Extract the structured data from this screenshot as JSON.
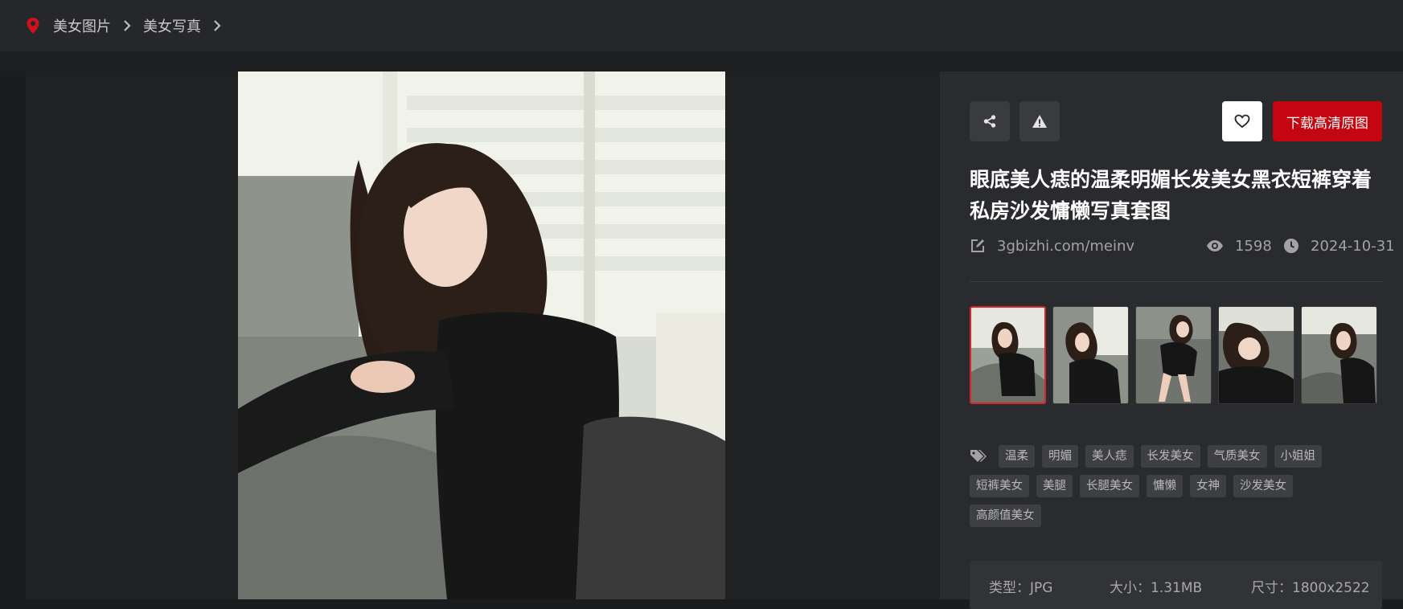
{
  "breadcrumb": {
    "items": [
      "美女图片",
      "美女写真"
    ]
  },
  "actions": {
    "download_label": "下载高清原图"
  },
  "post": {
    "title": "眼底美人痣的温柔明媚长发美女黑衣短裤穿着私房沙发慵懒写真套图",
    "source": "3gbizhi.com/meinv",
    "views": "1598",
    "date": "2024-10-31"
  },
  "thumbnails": {
    "count": 5,
    "active_index": 0
  },
  "tags": {
    "row1": [
      "温柔",
      "明媚",
      "美人痣",
      "长发美女",
      "气质美女",
      "小姐姐"
    ],
    "row2": [
      "短裤美女",
      "美腿",
      "长腿美女",
      "慵懒",
      "女神",
      "沙发美女"
    ],
    "row3": [
      "高颜值美女"
    ]
  },
  "file_info": {
    "type_label": "类型：JPG",
    "size_label": "大小：1.31MB",
    "dim_label": "尺寸：1800x2522"
  },
  "icons": {
    "location": "map-pin-icon",
    "chevron": "chevron-right-icon",
    "share": "share-icon",
    "report": "warning-icon",
    "favorite": "heart-icon",
    "edit": "edit-icon",
    "views": "eye-icon",
    "date": "clock-icon",
    "tags": "tags-icon"
  },
  "colors": {
    "accent": "#c3060f",
    "page_bg": "#1b1c1e",
    "panel_bg": "#2a2b2e",
    "topbar_bg": "#26272a"
  }
}
